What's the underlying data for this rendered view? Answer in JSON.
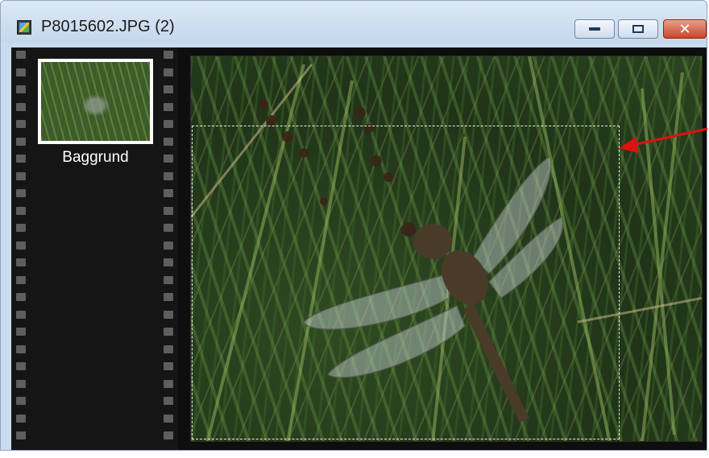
{
  "window": {
    "title": "P8015602.JPG (2)",
    "icon": "image-file-icon",
    "controls": [
      "minimize-icon",
      "maximize-icon",
      "close-icon"
    ]
  },
  "layers": [
    {
      "label": "Baggrund",
      "selected": true
    }
  ],
  "colors": {
    "title_bar": "#c9dbee",
    "filmstrip": "#151515",
    "close_button": "#c9452c",
    "annotation_arrow": "#e01010",
    "selection_marquee": "#e8e8e8"
  }
}
